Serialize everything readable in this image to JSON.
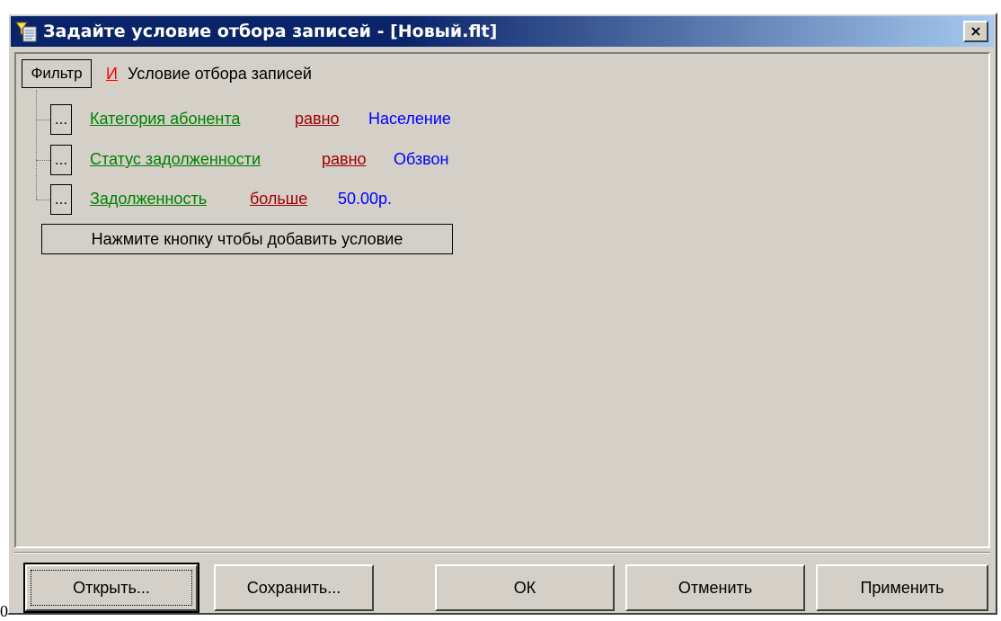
{
  "background_fragments": {
    "top": "",
    "bottom": "0"
  },
  "window": {
    "title": "Задайте условие отбора записей - [Новый.flt]",
    "close_glyph": "×",
    "app_icon": "filter-app-icon"
  },
  "filter": {
    "root_button": "Фильтр",
    "logic_operator": "И",
    "root_caption": "Условие отбора записей",
    "conditions": [
      {
        "button": "...",
        "field": "Категория абонента",
        "operator": "равно",
        "value": "Население"
      },
      {
        "button": "...",
        "field": "Статус задолженности",
        "operator": "равно",
        "value": "Обзвон"
      },
      {
        "button": "...",
        "field": "Задолженность",
        "operator": "больше",
        "value": "50.00р."
      }
    ],
    "add_condition_button": "Нажмите кнопку чтобы добавить условие"
  },
  "buttons": {
    "open": "Открыть...",
    "save": "Сохранить...",
    "ok": "ОК",
    "cancel": "Отменить",
    "apply": "Применить"
  },
  "colors": {
    "field_link": "#008000",
    "operator_link": "#a00000",
    "value": "#0000ff",
    "logic_operator": "#ff0000",
    "titlebar": "#0a246a",
    "face": "#d4d0c8"
  }
}
